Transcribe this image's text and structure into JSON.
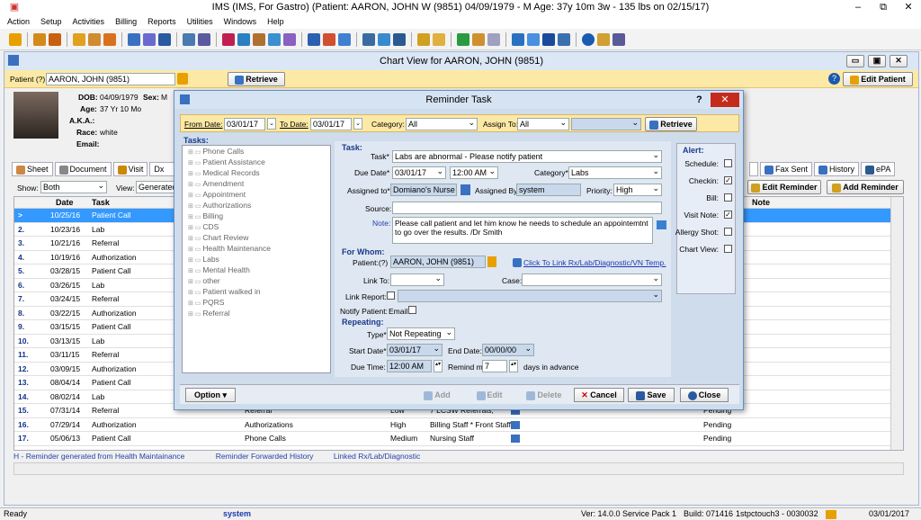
{
  "app": {
    "title": "IMS (IMS, For Gastro)     (Patient: AARON, JOHN W (9851) 04/09/1979 - M Age: 37y 10m 3w - 135 lbs on 02/15/17)"
  },
  "menu": [
    "Action",
    "Setup",
    "Activities",
    "Billing",
    "Reports",
    "Utilities",
    "Windows",
    "Help"
  ],
  "chart": {
    "title": "Chart View for AARON, JOHN  (9851)",
    "patient_label": "Patient (?)",
    "patient_value": "AARON, JOHN  (9851)",
    "retrieve": "Retrieve",
    "edit_patient": "Edit Patient",
    "dob_label": "DOB:",
    "dob": "04/09/1979",
    "sex_label": "Sex:",
    "sex": "M",
    "age_label": "Age:",
    "age": "37 Yr 10 Mo",
    "aka_label": "A.K.A.:",
    "race_label": "Race:",
    "race": "white",
    "email_label": "Email:",
    "tabs": [
      "Sheet",
      "Document",
      "Visit",
      "Dx",
      "Fax Sent",
      "History",
      "ePA"
    ],
    "show_label": "Show:",
    "show_value": "Both",
    "view_label": "View:",
    "view_value": "Generated",
    "edit_reminder": "Edit Reminder",
    "add_reminder": "Add Reminder",
    "cols": [
      "Date",
      "Task",
      "Note"
    ],
    "rows": [
      {
        "n": ">",
        "date": "10/25/16",
        "task": "Patient Call"
      },
      {
        "n": "2.",
        "date": "10/23/16",
        "task": "Lab"
      },
      {
        "n": "3.",
        "date": "10/21/16",
        "task": "Referral"
      },
      {
        "n": "4.",
        "date": "10/19/16",
        "task": "Authorization"
      },
      {
        "n": "5.",
        "date": "03/28/15",
        "task": "Patient Call"
      },
      {
        "n": "6.",
        "date": "03/26/15",
        "task": "Lab"
      },
      {
        "n": "7.",
        "date": "03/24/15",
        "task": "Referral"
      },
      {
        "n": "8.",
        "date": "03/22/15",
        "task": "Authorization"
      },
      {
        "n": "9.",
        "date": "03/15/15",
        "task": "Patient Call"
      },
      {
        "n": "10.",
        "date": "03/13/15",
        "task": "Lab"
      },
      {
        "n": "11.",
        "date": "03/11/15",
        "task": "Referral"
      },
      {
        "n": "12.",
        "date": "03/09/15",
        "task": "Authorization"
      },
      {
        "n": "13.",
        "date": "08/04/14",
        "task": "Patient Call"
      },
      {
        "n": "14.",
        "date": "08/02/14",
        "task": "Lab"
      },
      {
        "n": "15.",
        "date": "07/31/14",
        "task": "Referral",
        "cat": "Referral",
        "pri": "Low",
        "to": "7 LCSW Referrals, *",
        "status": "Pending"
      },
      {
        "n": "16.",
        "date": "07/29/14",
        "task": "Authorization",
        "cat": "Authorizations",
        "pri": "High",
        "to": "Billing Staff * Front Staff",
        "status": "Pending"
      },
      {
        "n": "17.",
        "date": "05/06/13",
        "task": "Patient Call",
        "cat": "Phone Calls",
        "pri": "Medium",
        "to": "Nursing Staff",
        "status": "Pending"
      }
    ],
    "legend_h": "H - Reminder generated from Health Maintainance",
    "legend_fwd": "Reminder Forwarded History",
    "legend_link": "Linked Rx/Lab/Diagnostic"
  },
  "dialog": {
    "title": "Reminder Task",
    "from_label": "From Date:",
    "from": "03/01/17",
    "to_label": "To Date:",
    "to": "03/01/17",
    "category_label": "Category:",
    "category": "All",
    "assign_label": "Assign To:",
    "assign": "All",
    "retrieve": "Retrieve",
    "tasks_hdr": "Tasks:",
    "tree": [
      "Phone Calls",
      "Patient Assistance",
      "Medical Records",
      "Amendment",
      "Appointment",
      "Authorizations",
      "Billing",
      "CDS",
      "Chart Review",
      "Health Maintenance",
      "Labs",
      "Mental Health",
      "other",
      "Patient walked in",
      "PQRS",
      "Referral"
    ],
    "task_hdr": "Task:",
    "task_label": "Task*",
    "task": "Labs are abnormal - Please notify patient",
    "due_label": "Due Date*",
    "due_date": "03/01/17",
    "due_time": "12:00 AM",
    "cat_label": "Category*",
    "cat": "Labs",
    "assigned_to_label": "Assigned to*",
    "assigned_to": "Domiano's Nurse",
    "assigned_by_label": "Assigned By:",
    "assigned_by": "system",
    "priority_label": "Priority:",
    "priority": "High",
    "source_label": "Source:",
    "note_label": "Note:",
    "note": "Please call patient and let him know he needs to schedule an appointemtnt to go over the results. /Dr Smith",
    "forwhom_hdr": "For Whom:",
    "patient_label": "Patient:(?)",
    "patient": "AARON, JOHN  (9851)",
    "link_click": "Click To Link Rx/Lab/Diagnostic/VN Temp.",
    "linkto_label": "Link To:",
    "case_label": "Case:",
    "linkreport_label": "Link Report:",
    "notify_label": "Notify Patient:",
    "email_label": "Email",
    "repeating_hdr": "Repeating:",
    "type_label": "Type*",
    "type": "Not Repeating",
    "start_label": "Start Date*",
    "start": "03/01/17",
    "end_label": "End Date:",
    "end": "00/00/00",
    "duetime_label": "Due Time:",
    "duetime": "12:00 AM",
    "remind_label": "Remind me:",
    "remind": "7",
    "days_label": "days in advance",
    "alert_hdr": "Alert:",
    "alerts": [
      {
        "label": "Schedule:",
        "checked": false
      },
      {
        "label": "Checkin:",
        "checked": true
      },
      {
        "label": "Bill:",
        "checked": false
      },
      {
        "label": "Visit Note:",
        "checked": true
      },
      {
        "label": "Allergy Shot:",
        "checked": false
      },
      {
        "label": "Chart View:",
        "checked": false
      }
    ],
    "option": "Option",
    "add": "Add",
    "edit": "Edit",
    "delete": "Delete",
    "cancel": "Cancel",
    "save": "Save",
    "close": "Close"
  },
  "status": {
    "ready": "Ready",
    "user": "system",
    "version": "Ver: 14.0.0 Service Pack 1",
    "build": "Build: 071416",
    "host": "1stpctouch3 - 0030032",
    "date": "03/01/2017"
  }
}
